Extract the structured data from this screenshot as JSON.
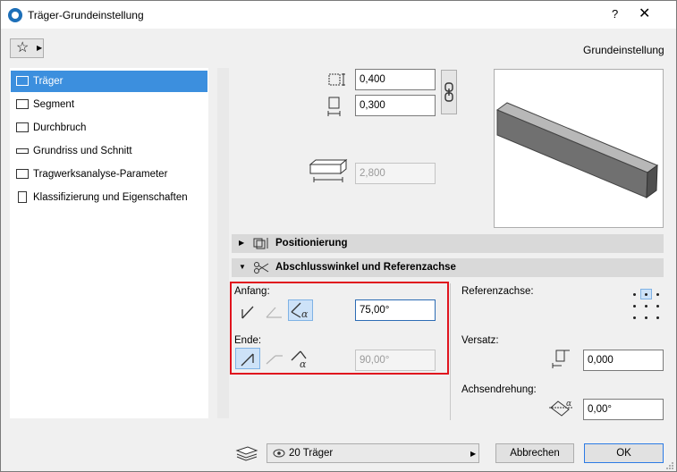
{
  "window": {
    "title": "Träger-Grundeinstellung",
    "help": "?",
    "close": "✕"
  },
  "header": {
    "favorites_icon": "star-icon",
    "mode_label": "Grundeinstellung"
  },
  "sidebar": {
    "items": [
      {
        "label": "Träger",
        "icon": "beam-icon",
        "selected": true
      },
      {
        "label": "Segment",
        "icon": "segment-icon",
        "selected": false
      },
      {
        "label": "Durchbruch",
        "icon": "hole-icon",
        "selected": false
      },
      {
        "label": "Grundriss und Schnitt",
        "icon": "floorplan-icon",
        "selected": false
      },
      {
        "label": "Tragwerksanalyse-Parameter",
        "icon": "structural-icon",
        "selected": false
      },
      {
        "label": "Klassifizierung und Eigenschaften",
        "icon": "classification-icon",
        "selected": false
      }
    ]
  },
  "geometry": {
    "width": "0,400",
    "height": "0,300",
    "length": "2,800"
  },
  "sections": {
    "positioning": "Positionierung",
    "end_angles": "Abschlusswinkel und Referenzachse"
  },
  "end_angles": {
    "start_label": "Anfang:",
    "start_angle": "75,00°",
    "end_label": "Ende:",
    "end_angle": "90,00°"
  },
  "reference": {
    "axis_label": "Referenzachse:",
    "offset_label": "Versatz:",
    "offset_value": "0,000",
    "rotation_label": "Achsendrehung:",
    "rotation_value": "0,00°"
  },
  "footer": {
    "layer": "20 Träger",
    "cancel": "Abbrechen",
    "ok": "OK"
  },
  "colors": {
    "selection": "#3c8fde",
    "highlight_box": "#e0141e",
    "default_button_border": "#2c7be5"
  }
}
